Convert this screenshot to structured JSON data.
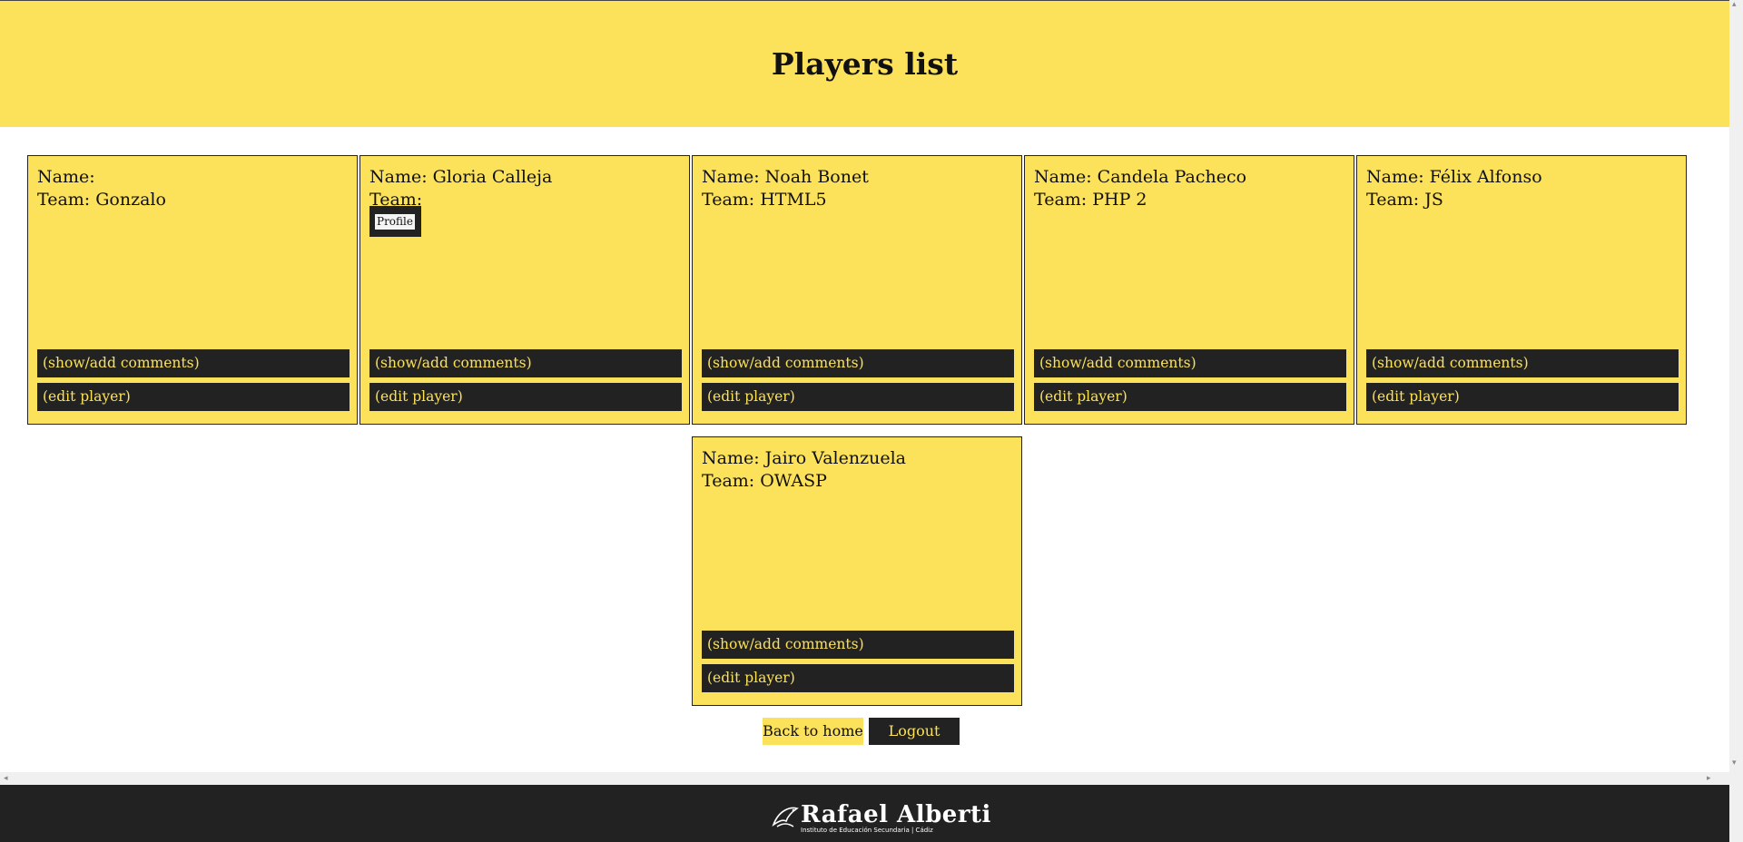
{
  "header": {
    "title": "Players list"
  },
  "players": [
    {
      "name_line": "Name: ",
      "team_line": "Team: Gonzalo",
      "comments": "(show/add comments)",
      "edit": "(edit player)"
    },
    {
      "name_line": "Name: Gloria Calleja",
      "team_line": "Team: ",
      "profile": "Profile",
      "comments": "(show/add comments)",
      "edit": "(edit player)"
    },
    {
      "name_line": "Name: Noah Bonet",
      "team_line": "Team: HTML5",
      "comments": "(show/add comments)",
      "edit": "(edit player)"
    },
    {
      "name_line": "Name: Candela Pacheco",
      "team_line": "Team: PHP 2",
      "comments": "(show/add comments)",
      "edit": "(edit player)"
    },
    {
      "name_line": "Name: Félix Alfonso",
      "team_line": "Team: JS",
      "comments": "(show/add comments)",
      "edit": "(edit player)"
    },
    {
      "name_line": "Name: Jairo Valenzuela",
      "team_line": "Team: OWASP",
      "comments": "(show/add comments)",
      "edit": "(edit player)"
    }
  ],
  "nav": {
    "home": "Back to home",
    "logout": "Logout"
  },
  "footer": {
    "logo_name": "Rafael Alberti",
    "logo_sub": "Instituto de Educación Secundaria | Cádiz"
  },
  "colors": {
    "accent": "#fce15a",
    "dark": "#222222"
  }
}
